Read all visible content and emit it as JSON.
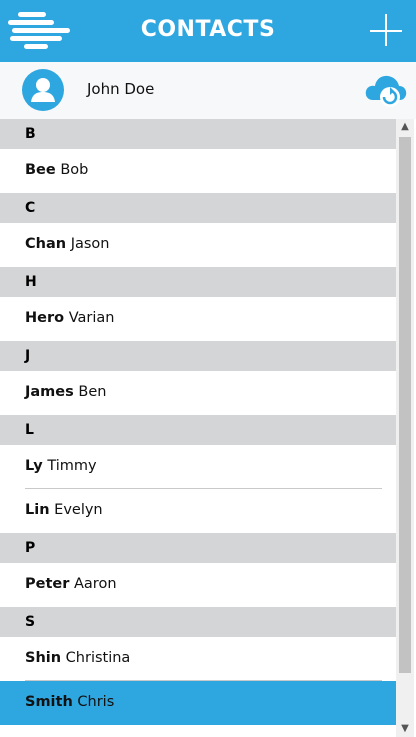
{
  "header": {
    "title": "CONTACTS",
    "menu_icon": "hamburger-menu-icon",
    "add_icon": "plus-icon",
    "color": "#2ea6e0"
  },
  "user": {
    "name": "John Doe",
    "avatar_icon": "user-avatar-icon",
    "sync_icon": "cloud-sync-icon"
  },
  "groups": [
    {
      "letter": "B",
      "contacts": [
        {
          "last": "Bee",
          "first": "Bob"
        }
      ]
    },
    {
      "letter": "C",
      "contacts": [
        {
          "last": "Chan",
          "first": "Jason"
        }
      ]
    },
    {
      "letter": "H",
      "contacts": [
        {
          "last": "Hero",
          "first": "Varian"
        }
      ]
    },
    {
      "letter": "J",
      "contacts": [
        {
          "last": "James",
          "first": "Ben"
        }
      ]
    },
    {
      "letter": "L",
      "contacts": [
        {
          "last": "Ly",
          "first": "Timmy"
        },
        {
          "last": "Lin",
          "first": "Evelyn"
        }
      ]
    },
    {
      "letter": "P",
      "contacts": [
        {
          "last": "Peter",
          "first": "Aaron"
        }
      ]
    },
    {
      "letter": "S",
      "contacts": [
        {
          "last": "Shin",
          "first": "Christina"
        },
        {
          "last": "Smith",
          "first": "Chris"
        }
      ]
    }
  ],
  "selected_contact": "Smith Chris",
  "scrollbar": {
    "up_icon": "scroll-up-arrow-icon",
    "down_icon": "scroll-down-arrow-icon"
  }
}
